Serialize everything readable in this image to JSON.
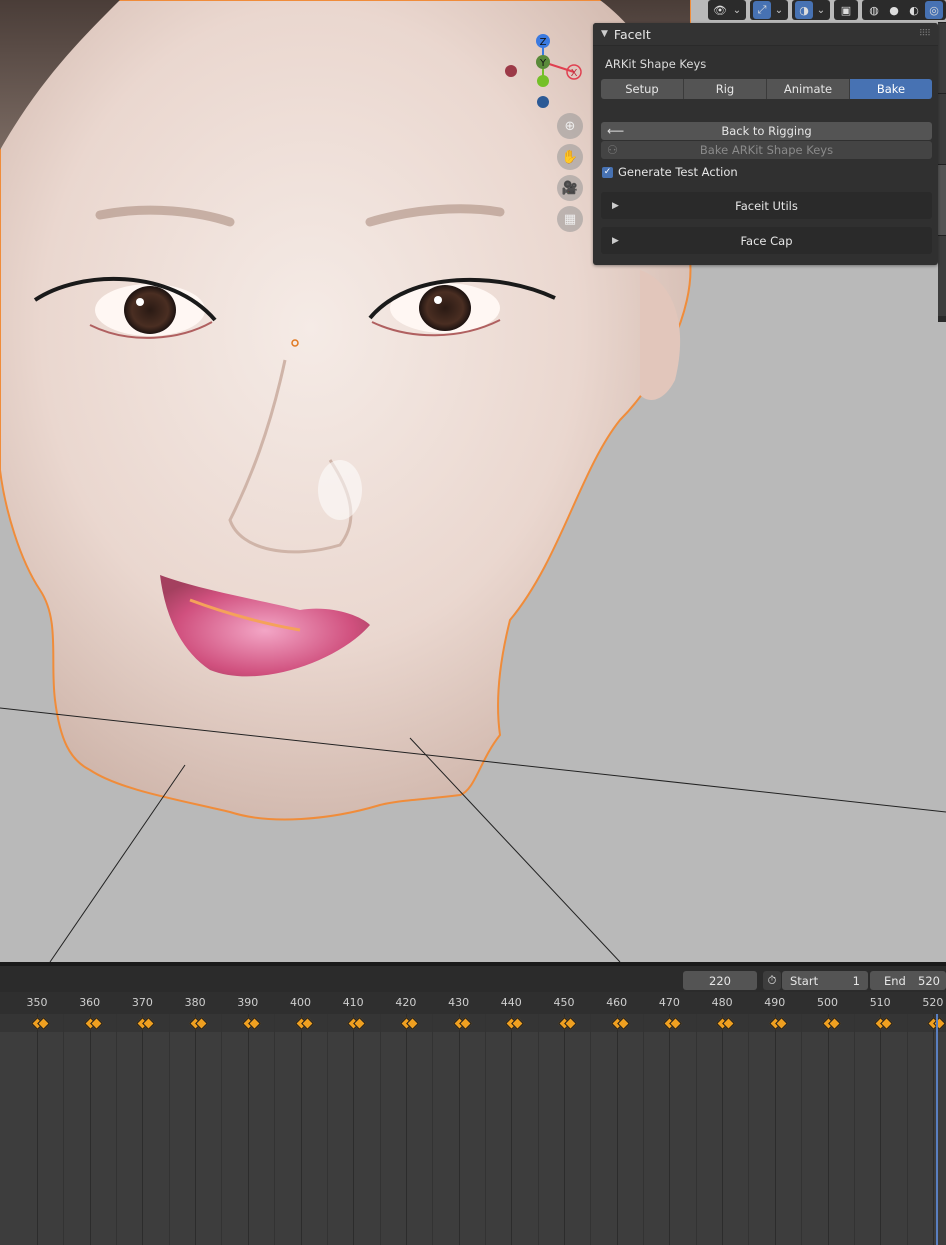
{
  "header_toolbar": {
    "groups": [
      {
        "name": "visibility",
        "icons": [
          "eye-icon",
          "chevron-down-icon"
        ]
      },
      {
        "name": "gizmo",
        "icons": [
          "gizmo-icon",
          "chevron-down-icon"
        ]
      },
      {
        "name": "overlay",
        "icons": [
          "overlay-icon",
          "chevron-down-icon"
        ]
      },
      {
        "name": "xray",
        "icons": [
          "xray-icon"
        ]
      },
      {
        "name": "shading",
        "icons": [
          "wireframe-icon",
          "solid-icon",
          "material-icon",
          "rendered-icon"
        ]
      }
    ]
  },
  "facelt_panel": {
    "title": "FaceIt",
    "section_label": "ARKit Shape Keys",
    "tabs": [
      {
        "label": "Setup",
        "active": false
      },
      {
        "label": "Rig",
        "active": false
      },
      {
        "label": "Animate",
        "active": false
      },
      {
        "label": "Bake",
        "active": true
      }
    ],
    "back_button": {
      "label": "Back to Rigging",
      "icon": "back-arrow-icon"
    },
    "bake_button": {
      "label": "Bake ARKit Shape Keys",
      "icon": "user-icon",
      "disabled": true
    },
    "checkbox": {
      "label": "Generate Test Action",
      "checked": true
    },
    "subpanels": [
      {
        "label": "Faceit Utils",
        "expanded": false
      },
      {
        "label": "Face Cap",
        "expanded": false
      }
    ]
  },
  "nav_gizmo": {
    "axes": [
      "Z",
      "Y",
      "X"
    ]
  },
  "nav_buttons": [
    "zoom-icon",
    "hand-icon",
    "camera-icon",
    "grid-icon"
  ],
  "timeline": {
    "current_frame": "220",
    "start_label": "Start",
    "start_value": "1",
    "end_label": "End",
    "end_value": "520",
    "ticks": [
      "350",
      "360",
      "370",
      "380",
      "390",
      "400",
      "410",
      "420",
      "430",
      "440",
      "450",
      "460",
      "470",
      "480",
      "490",
      "500",
      "510",
      "520"
    ],
    "colors": {
      "keyframe": "#f0a020",
      "accent": "#4772b3"
    }
  }
}
